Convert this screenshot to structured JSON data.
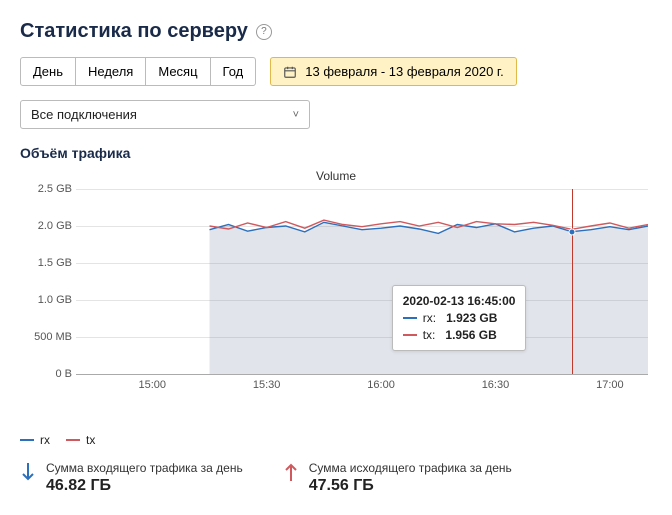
{
  "header": {
    "title": "Статистика по серверу",
    "help": "?"
  },
  "period_tabs": [
    "День",
    "Неделя",
    "Месяц",
    "Год"
  ],
  "date_range": "13 февраля - 13 февраля 2020 г.",
  "connection_select": {
    "value": "Все подключения"
  },
  "traffic_section_title": "Объём трафика",
  "chart_data": {
    "type": "line",
    "title": "Volume",
    "xlabel": "",
    "ylabel": "",
    "y_ticks": [
      "0 B",
      "500 MB",
      "1.0 GB",
      "1.5 GB",
      "2.0 GB",
      "2.5 GB"
    ],
    "x_ticks": [
      "15:00",
      "15:30",
      "16:00",
      "16:30",
      "17:00"
    ],
    "xlim_minutes": [
      880,
      1030
    ],
    "ylim_gb": [
      0,
      2.5
    ],
    "x_minutes": [
      915,
      920,
      925,
      930,
      935,
      940,
      945,
      950,
      955,
      960,
      965,
      970,
      975,
      980,
      985,
      990,
      995,
      1000,
      1005,
      1010,
      1015,
      1020,
      1025,
      1030
    ],
    "series": [
      {
        "name": "rx",
        "color": "#2c6fbb",
        "values_gb": [
          1.95,
          2.02,
          1.93,
          1.98,
          2.0,
          1.92,
          2.05,
          2.0,
          1.95,
          1.97,
          2.0,
          1.96,
          1.9,
          2.02,
          1.98,
          2.03,
          1.92,
          1.97,
          2.0,
          1.923,
          1.95,
          1.99,
          1.95,
          2.0
        ]
      },
      {
        "name": "tx",
        "color": "#d0595e",
        "values_gb": [
          2.0,
          1.96,
          2.04,
          1.98,
          2.06,
          1.97,
          2.08,
          2.02,
          1.99,
          2.03,
          2.06,
          2.0,
          2.05,
          1.98,
          2.06,
          2.03,
          2.02,
          2.05,
          2.01,
          1.956,
          2.0,
          2.04,
          1.97,
          2.02
        ]
      }
    ],
    "cursor": {
      "minute": 1010,
      "timestamp": "2020-02-13 16:45:00",
      "rx_label": "rx:",
      "rx_value": "1.923 GB",
      "tx_label": "tx:",
      "tx_value": "1.956 GB"
    }
  },
  "legend": {
    "rx": "rx",
    "tx": "tx"
  },
  "summary": {
    "incoming_label": "Сумма входящего трафика за день",
    "incoming_value": "46.82 ГБ",
    "outgoing_label": "Сумма исходящего трафика за день",
    "outgoing_value": "47.56 ГБ"
  }
}
